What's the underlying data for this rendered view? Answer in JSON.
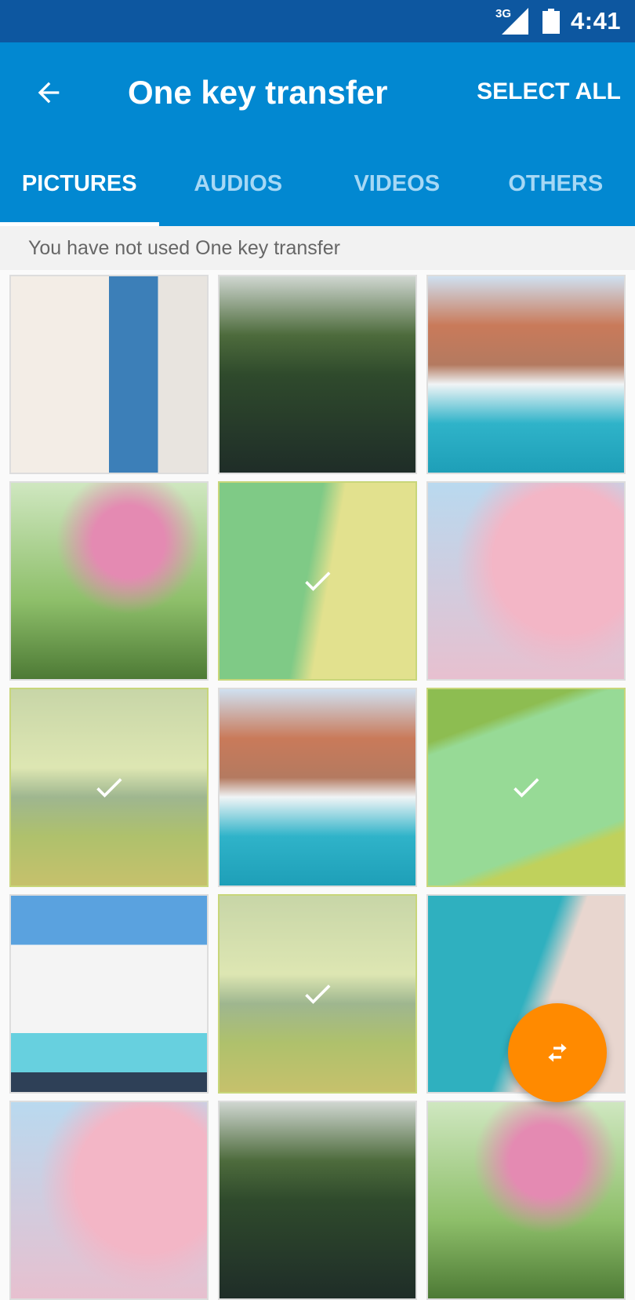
{
  "status_bar": {
    "network": "3G",
    "time": "4:41"
  },
  "app_bar": {
    "title": "One key transfer",
    "action_label": "SELECT ALL",
    "back_icon": "arrow-back-icon"
  },
  "tabs": [
    {
      "label": "PICTURES",
      "active": true
    },
    {
      "label": "AUDIOS",
      "active": false
    },
    {
      "label": "VIDEOS",
      "active": false
    },
    {
      "label": "OTHERS",
      "active": false
    }
  ],
  "notice": "You have not used One key transfer",
  "colors": {
    "status_bar": "#0D57A0",
    "app_bar": "#0288D1",
    "fab": "#FF8A00",
    "inactive_tab": "#A6D8F5"
  },
  "pictures": [
    {
      "subject": "greek-alley-cafe",
      "selected": false
    },
    {
      "subject": "mountain-lake-boat",
      "selected": false
    },
    {
      "subject": "venice-frozen-canal",
      "selected": false
    },
    {
      "subject": "pink-blossom-branch",
      "selected": false
    },
    {
      "subject": "aerial-beach-cove",
      "selected": true
    },
    {
      "subject": "cherry-blossoms",
      "selected": false
    },
    {
      "subject": "mount-fuji",
      "selected": true
    },
    {
      "subject": "venice-frozen-canal",
      "selected": false
    },
    {
      "subject": "aerial-lagoon",
      "selected": true
    },
    {
      "subject": "santorini-pool",
      "selected": false
    },
    {
      "subject": "mount-fuji",
      "selected": true
    },
    {
      "subject": "aerial-beach-rocks",
      "selected": false
    },
    {
      "subject": "cherry-blossoms",
      "selected": false
    },
    {
      "subject": "mountain-lake-boat",
      "selected": false
    },
    {
      "subject": "pink-blossom-branch",
      "selected": false
    }
  ],
  "fab": {
    "icon": "swap-arrows-icon"
  }
}
